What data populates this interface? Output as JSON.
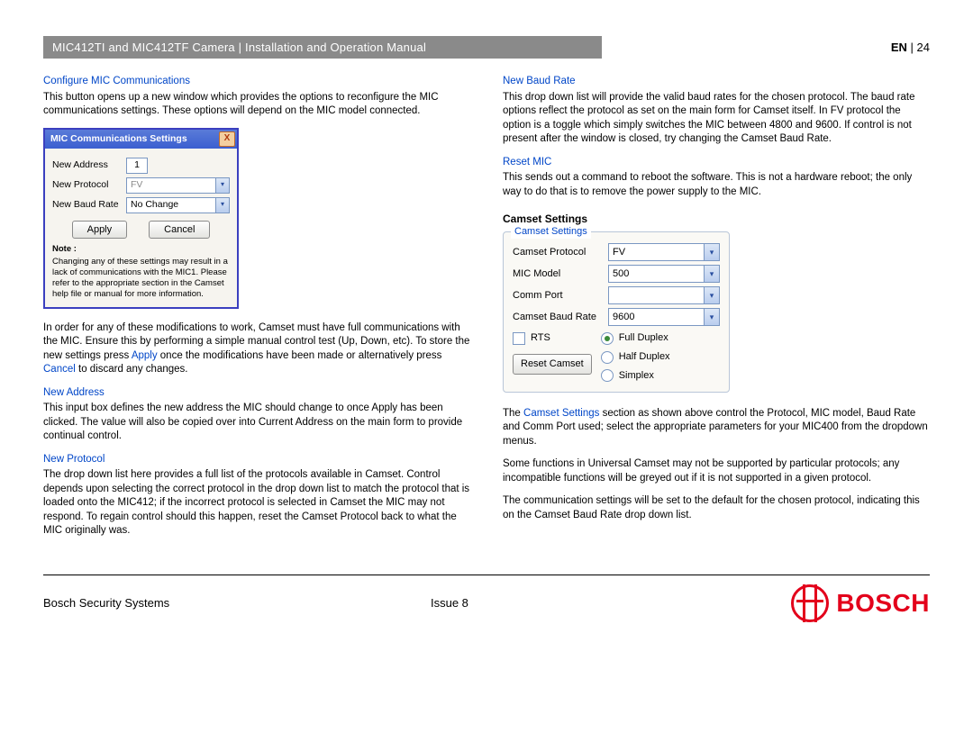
{
  "header": {
    "title": "MIC412TI and MIC412TF Camera | Installation and Operation Manual",
    "lang": "EN",
    "sep": " | ",
    "page": "24"
  },
  "left": {
    "h_configure": "Configure MIC Communications",
    "p_configure": "This button opens up a new window which provides the options to reconfigure the MIC communications settings. These options will depend on the MIC model connected.",
    "dlg": {
      "title": "MIC Communications Settings",
      "row_addr_label": "New Address",
      "row_addr_value": "1",
      "row_proto_label": "New Protocol",
      "row_proto_value": "FV",
      "row_baud_label": "New Baud Rate",
      "row_baud_value": "No Change",
      "btn_apply": "Apply",
      "btn_cancel": "Cancel",
      "note_heading": "Note :",
      "note_body": "Changing any of these settings may result in a lack of communications with the MIC1.  Please refer to the appropriate section in the Camset help file or manual for more information."
    },
    "p_mod_1": "In order for any of these modifications to work, Camset must have full communications with the MIC. Ensure this by performing a simple manual control test (Up, Down, etc). To store the new settings press ",
    "apply_word": "Apply",
    "p_mod_2": " once the modifications have been made or alternatively press ",
    "cancel_word": "Cancel",
    "p_mod_3": " to discard any changes.",
    "h_newaddr": "New Address",
    "p_newaddr": "This input box defines the new address the MIC should change to once Apply has been clicked. The value will also be copied over into Current Address on the main form to provide continual control.",
    "h_newproto": "New Protocol",
    "p_newproto": "The drop down list here provides a full list of the protocols available in Camset. Control depends upon selecting the correct protocol in the drop down list to match the protocol that is loaded onto the MIC412; if the incorrect protocol is selected in Camset the MIC may not respond. To regain control should this happen, reset the Camset Protocol back to what the MIC originally was."
  },
  "right": {
    "h_newbaud": "New Baud Rate",
    "p_newbaud": "This drop down list will provide the valid baud rates for the chosen protocol. The baud rate options reflect the protocol as set on the main form for Camset itself. In FV protocol the option is a toggle which simply switches the MIC between 4800 and 9600. If control is not present after the window is closed, try changing the Camset Baud Rate.",
    "h_reset": "Reset MIC",
    "p_reset": "This sends out a command to reboot the software. This is not a hardware reboot; the only way to do that is to remove the power supply to the MIC.",
    "h_camset": "Camset Settings",
    "gbox": {
      "title": "Camset Settings",
      "proto_label": "Camset Protocol",
      "proto_value": "FV",
      "model_label": "MIC Model",
      "model_value": "500",
      "comm_label": "Comm Port",
      "comm_value": "",
      "baud_label": "Camset Baud Rate",
      "baud_value": "9600",
      "rts_label": "RTS",
      "reset_btn": "Reset Camset",
      "radio_full": "Full Duplex",
      "radio_half": "Half Duplex",
      "radio_simplex": "Simplex"
    },
    "p_camset_1a": "The ",
    "p_camset_1_link": "Camset Settings",
    "p_camset_1b": " section as shown above control the Protocol, MIC model, Baud Rate and Comm Port used; select the appropriate parameters for your MIC400 from the dropdown menus.",
    "p_camset_2": "Some functions in Universal Camset may not be supported by particular protocols; any incompatible functions will be greyed out if it is not supported in a given protocol.",
    "p_camset_3": "The communication settings will be set to the default for the chosen protocol, indicating this on the Camset Baud Rate drop down list."
  },
  "footer": {
    "company": "Bosch Security Systems",
    "issue": "Issue 8",
    "brand": "BOSCH"
  }
}
